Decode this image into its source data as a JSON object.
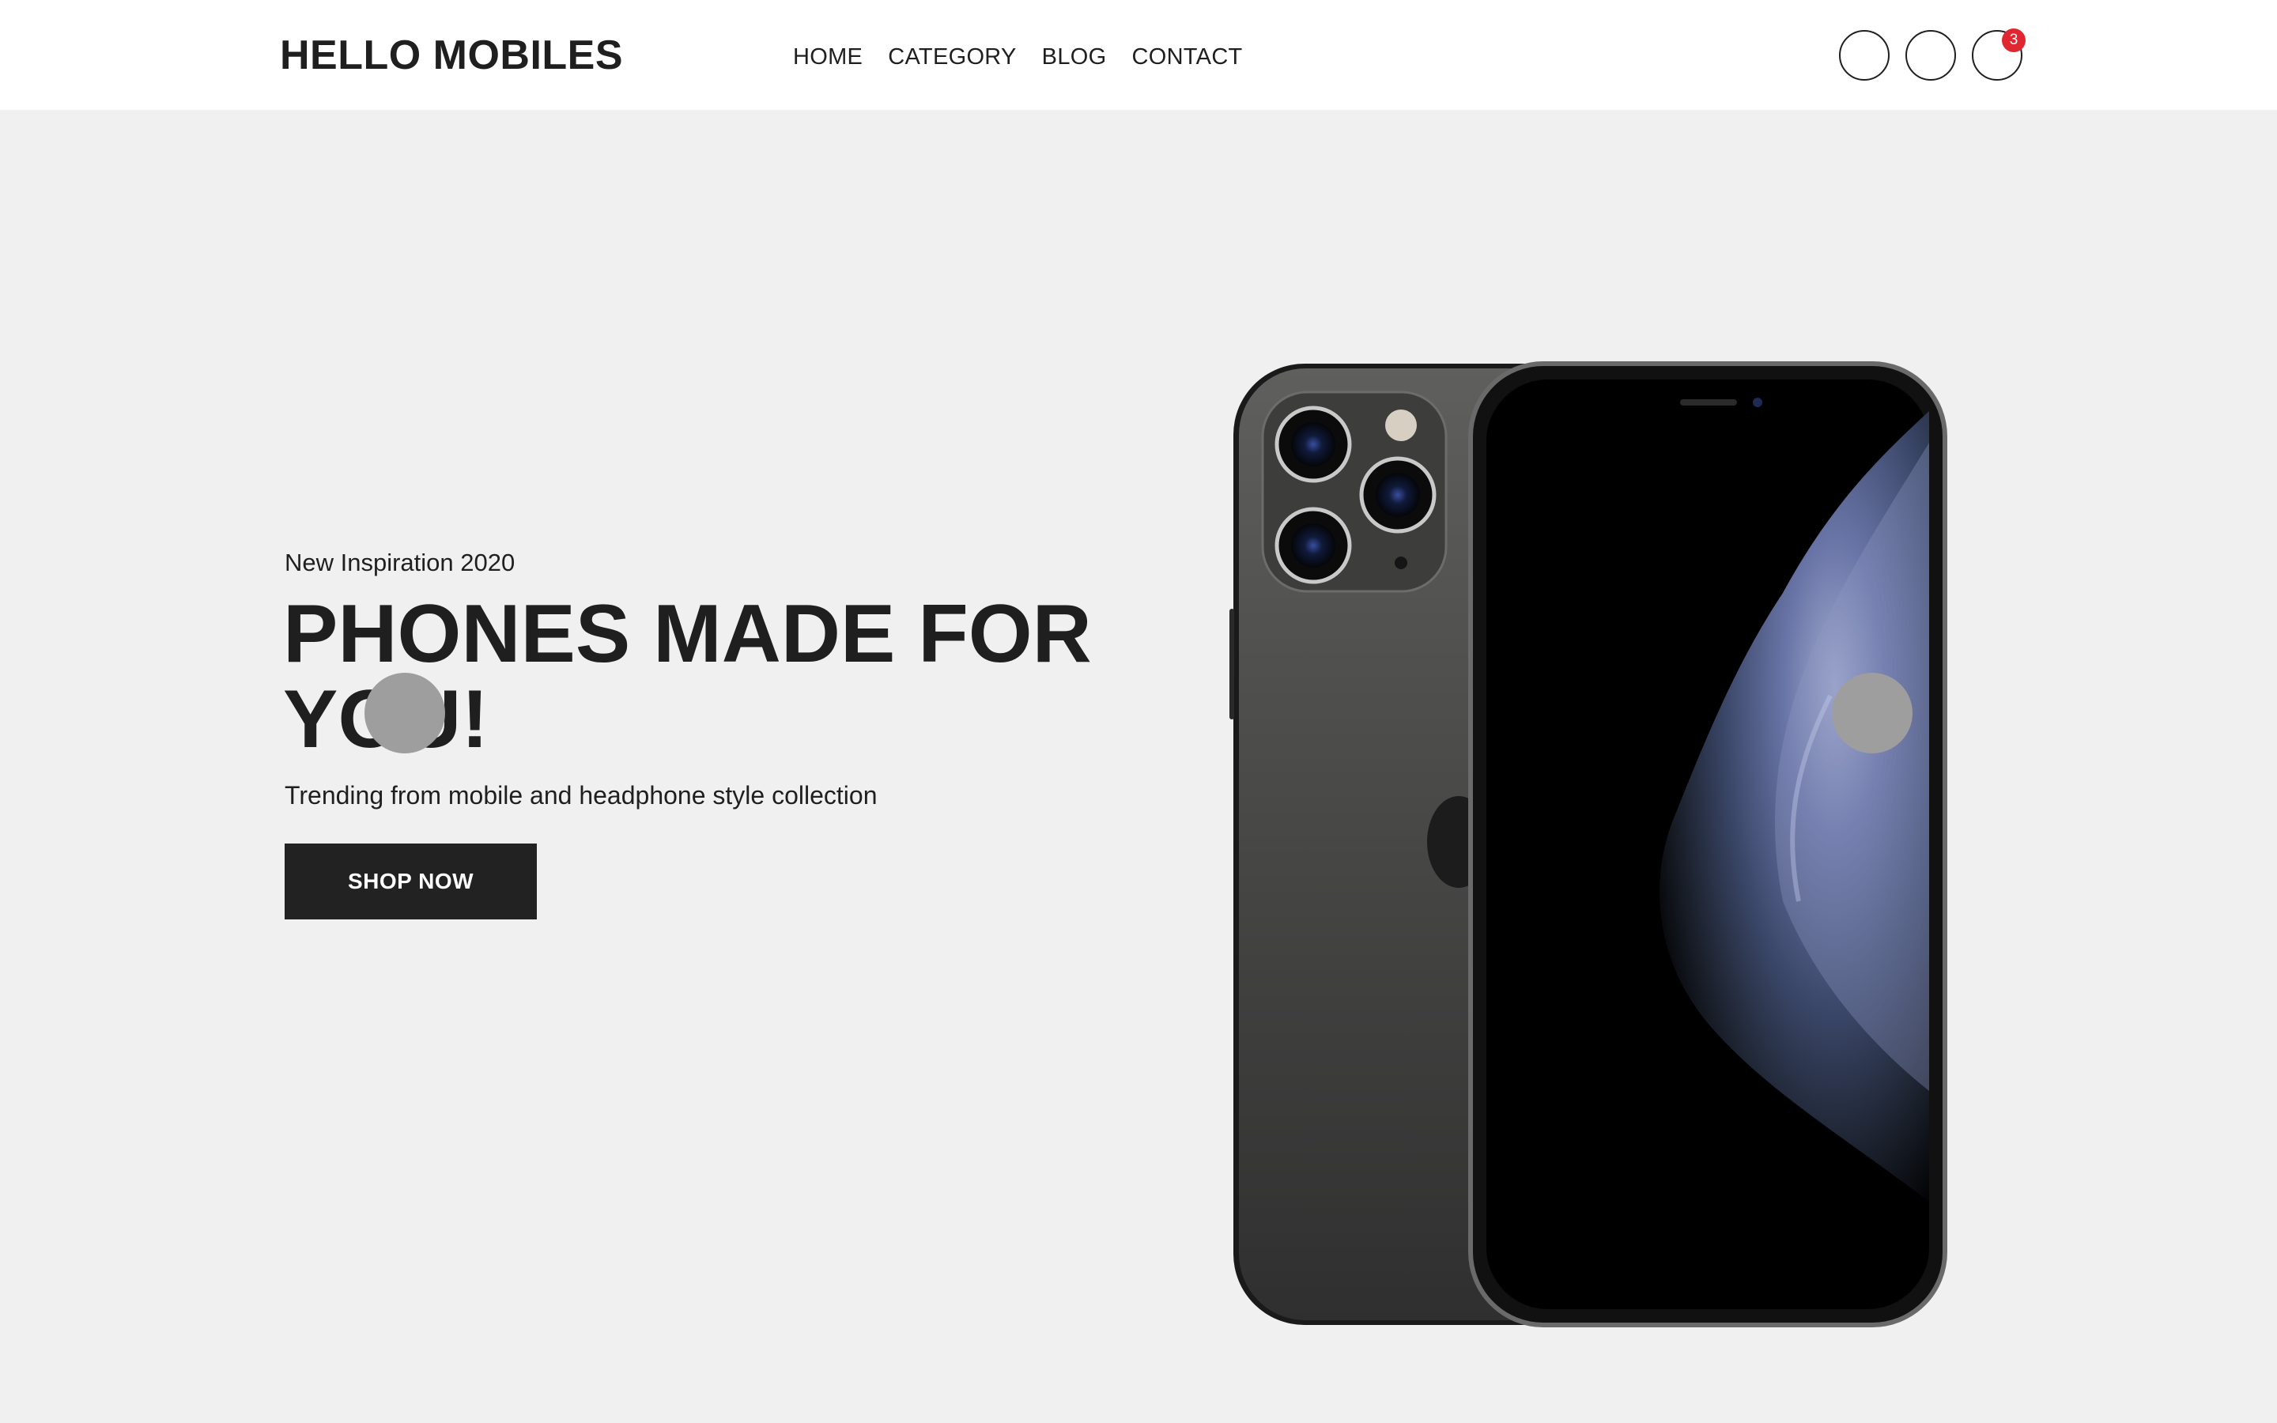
{
  "header": {
    "logo": "HELLO MOBILES",
    "nav": [
      "HOME",
      "CATEGORY",
      "BLOG",
      "CONTACT"
    ],
    "icons": [
      "search-icon",
      "user-icon",
      "cart-icon"
    ],
    "cart_count": "3"
  },
  "hero": {
    "eyebrow": "New Inspiration 2020",
    "headline_line1": "PHONES MADE FOR",
    "headline_line2": "YOU!",
    "subtitle": "Trending from mobile and headphone style collection",
    "cta_label": "SHOP NOW",
    "image": "smartphone-product-image"
  },
  "colors": {
    "text": "#1f1f1f",
    "background": "#f0f0f0",
    "header_bg": "#ffffff",
    "button_bg": "#222222",
    "badge": "#e0262f",
    "slider_dot": "#9e9e9e"
  }
}
